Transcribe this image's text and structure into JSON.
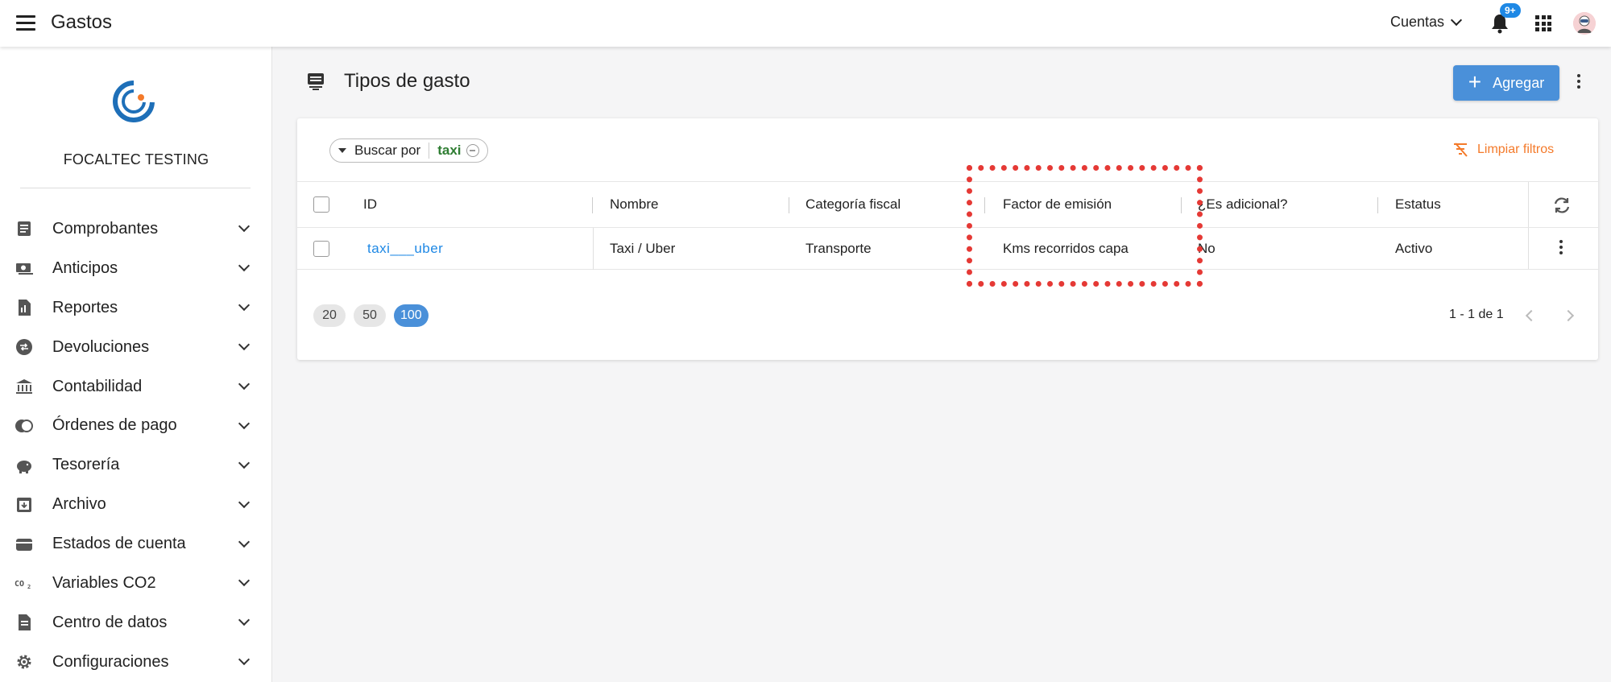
{
  "app": {
    "title": "Gastos"
  },
  "header": {
    "accounts_label": "Cuentas",
    "notifications_badge": "9+"
  },
  "sidebar": {
    "company": "FOCALTEC TESTING",
    "items": [
      {
        "label": "Comprobantes",
        "icon": "document-icon"
      },
      {
        "label": "Anticipos",
        "icon": "cash-icon"
      },
      {
        "label": "Reportes",
        "icon": "report-icon"
      },
      {
        "label": "Devoluciones",
        "icon": "refund-icon"
      },
      {
        "label": "Contabilidad",
        "icon": "bank-icon"
      },
      {
        "label": "Órdenes de pago",
        "icon": "payment-order-icon"
      },
      {
        "label": "Tesorería",
        "icon": "piggy-bank-icon"
      },
      {
        "label": "Archivo",
        "icon": "archive-icon"
      },
      {
        "label": "Estados de cuenta",
        "icon": "wallet-icon"
      },
      {
        "label": "Variables CO2",
        "icon": "co2-icon"
      },
      {
        "label": "Centro de datos",
        "icon": "data-center-icon"
      },
      {
        "label": "Configuraciones",
        "icon": "gear-icon"
      }
    ]
  },
  "page": {
    "title": "Tipos de gasto",
    "add_label": "Agregar"
  },
  "filter": {
    "label": "Buscar por",
    "value": "taxi",
    "clear_label": "Limpiar filtros"
  },
  "table": {
    "columns": [
      "ID",
      "Nombre",
      "Categoría fiscal",
      "Factor de emisión",
      "¿Es adicional?",
      "Estatus"
    ],
    "rows": [
      {
        "id": "taxi___uber",
        "nombre": "Taxi / Uber",
        "categoria": "Transporte",
        "factor": "Kms recorridos capa",
        "adicional": "No",
        "estatus": "Activo"
      }
    ]
  },
  "pagination": {
    "sizes": [
      "20",
      "50",
      "100"
    ],
    "active_size": "100",
    "range_text": "1 - 1 de 1"
  },
  "colors": {
    "accent": "#4a90d9",
    "link": "#1e88e5",
    "clear": "#f47a2a",
    "filter_value": "#2e7d32",
    "highlight": "#e53935"
  }
}
